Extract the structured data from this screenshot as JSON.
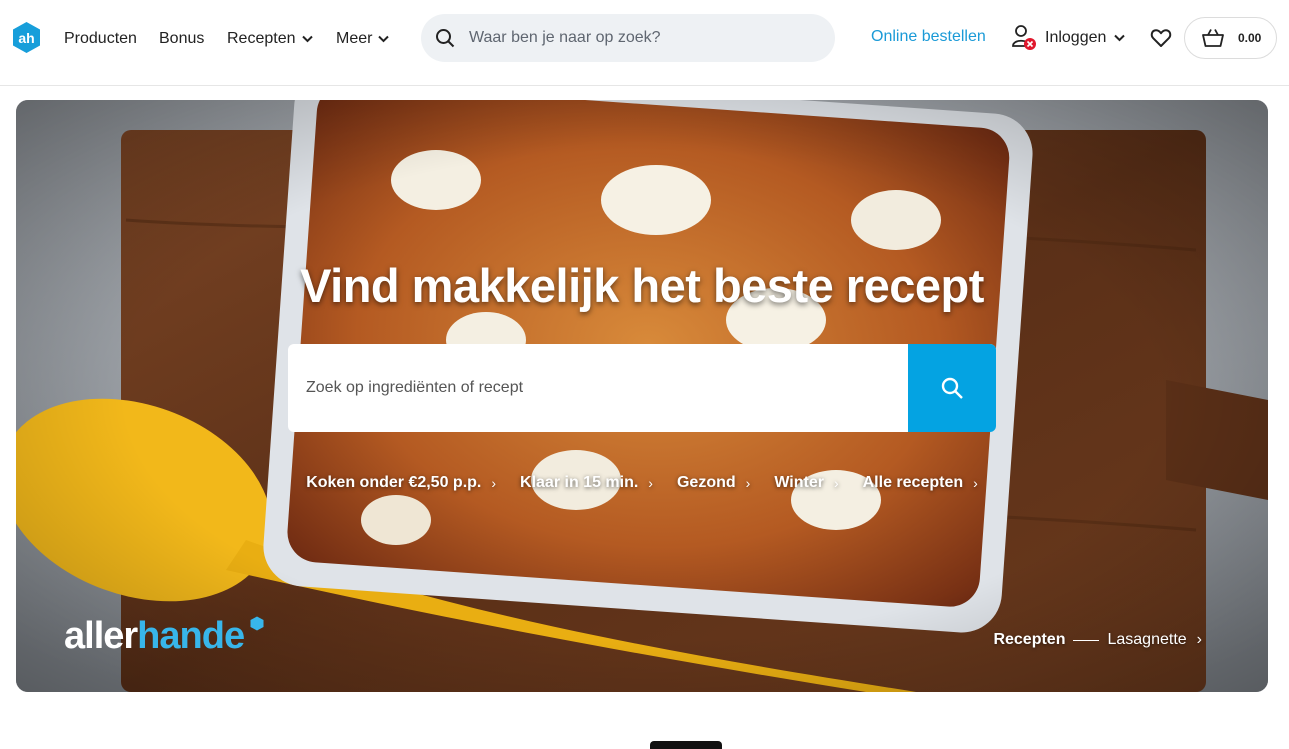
{
  "header": {
    "nav": [
      {
        "label": "Producten",
        "has_dropdown": false
      },
      {
        "label": "Bonus",
        "has_dropdown": false
      },
      {
        "label": "Recepten",
        "has_dropdown": true
      },
      {
        "label": "Meer",
        "has_dropdown": true
      }
    ],
    "search_placeholder": "Waar ben je naar op zoek?",
    "online_label": "Online bestellen",
    "login_label": "Inloggen",
    "cart_amount": "0.00"
  },
  "hero": {
    "title": "Vind makkelijk het beste recept",
    "search_placeholder": "Zoek op ingrediënten of recept",
    "quick_links": [
      {
        "label": "Koken onder €2,50 p.p."
      },
      {
        "label": "Klaar in 15 min."
      },
      {
        "label": "Gezond"
      },
      {
        "label": "Winter"
      },
      {
        "label": "Alle recepten"
      }
    ],
    "brand_part1": "aller",
    "brand_part2": "hande",
    "breadcrumb_1": "Recepten",
    "breadcrumb_2": "Lasagnette"
  },
  "colors": {
    "accent": "#04a3e2",
    "link": "#1a9ad7",
    "logo": "#179eda"
  },
  "icons": [
    "ah-logo-icon",
    "chevron-down-icon",
    "search-icon",
    "user-icon",
    "heart-icon",
    "basket-icon",
    "chevron-right-icon"
  ]
}
